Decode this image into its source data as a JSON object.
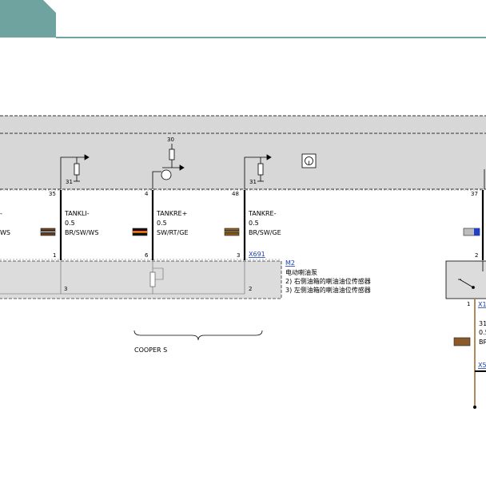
{
  "header": {
    "tab_color": "#6fa3a0",
    "rule_color": "#6fa3a0"
  },
  "control_unit": {
    "fill": "#d7d7d7"
  },
  "wires": [
    {
      "id": "w_left",
      "top_pin": "",
      "bottom_pin": "",
      "lines": [
        "",
        "",
        "WS"
      ]
    },
    {
      "id": "w1",
      "top_pin": "35",
      "bottom_pin": "1",
      "name": "TANKLI-",
      "size": "0.5",
      "color_code": "BR/SW/WS",
      "swatch": [
        "#6b3f1f",
        "#111111",
        "#ffffff"
      ]
    },
    {
      "id": "w2",
      "top_pin": "4",
      "bottom_pin": "6",
      "name": "TANKRE+",
      "size": "0.5",
      "color_code": "SW/RT/GE",
      "swatch": [
        "#111111",
        "#d8321e",
        "#e7c400"
      ]
    },
    {
      "id": "w3",
      "top_pin": "48",
      "bottom_pin": "3",
      "name": "TANKRE-",
      "size": "0.5",
      "color_code": "BR/SW/GE",
      "swatch": [
        "#8a5a2a",
        "#111111",
        "#e7c400"
      ]
    },
    {
      "id": "w4",
      "top_pin": "37",
      "bottom_pin": "2",
      "swatch": [
        "#bdbdbd",
        "#2040c8"
      ]
    }
  ],
  "labels": {
    "sensor_supply": "30",
    "ground_1": "31",
    "ground_2": "31",
    "connector_x691": "X691",
    "m2_link": "M2",
    "m2_desc": "电动喇油泵",
    "note_2": "2)   右侧油箱的喇油油位传感器",
    "note_3": "3)   左侧油箱的喇油油位传感器",
    "pump_pin_3": "3",
    "pump_pin_2": "2",
    "variant_label": "COOPER S",
    "relay_pin": "1",
    "relay_conn": "X1",
    "right_wire_31": "31",
    "right_wire_size": "0.5",
    "right_wire_color": "BR",
    "right_conn": "X5"
  },
  "colors": {
    "brown_wire": "#b08a5a",
    "link": "#1a3fb0",
    "module_fill": "#dcdcdc"
  }
}
